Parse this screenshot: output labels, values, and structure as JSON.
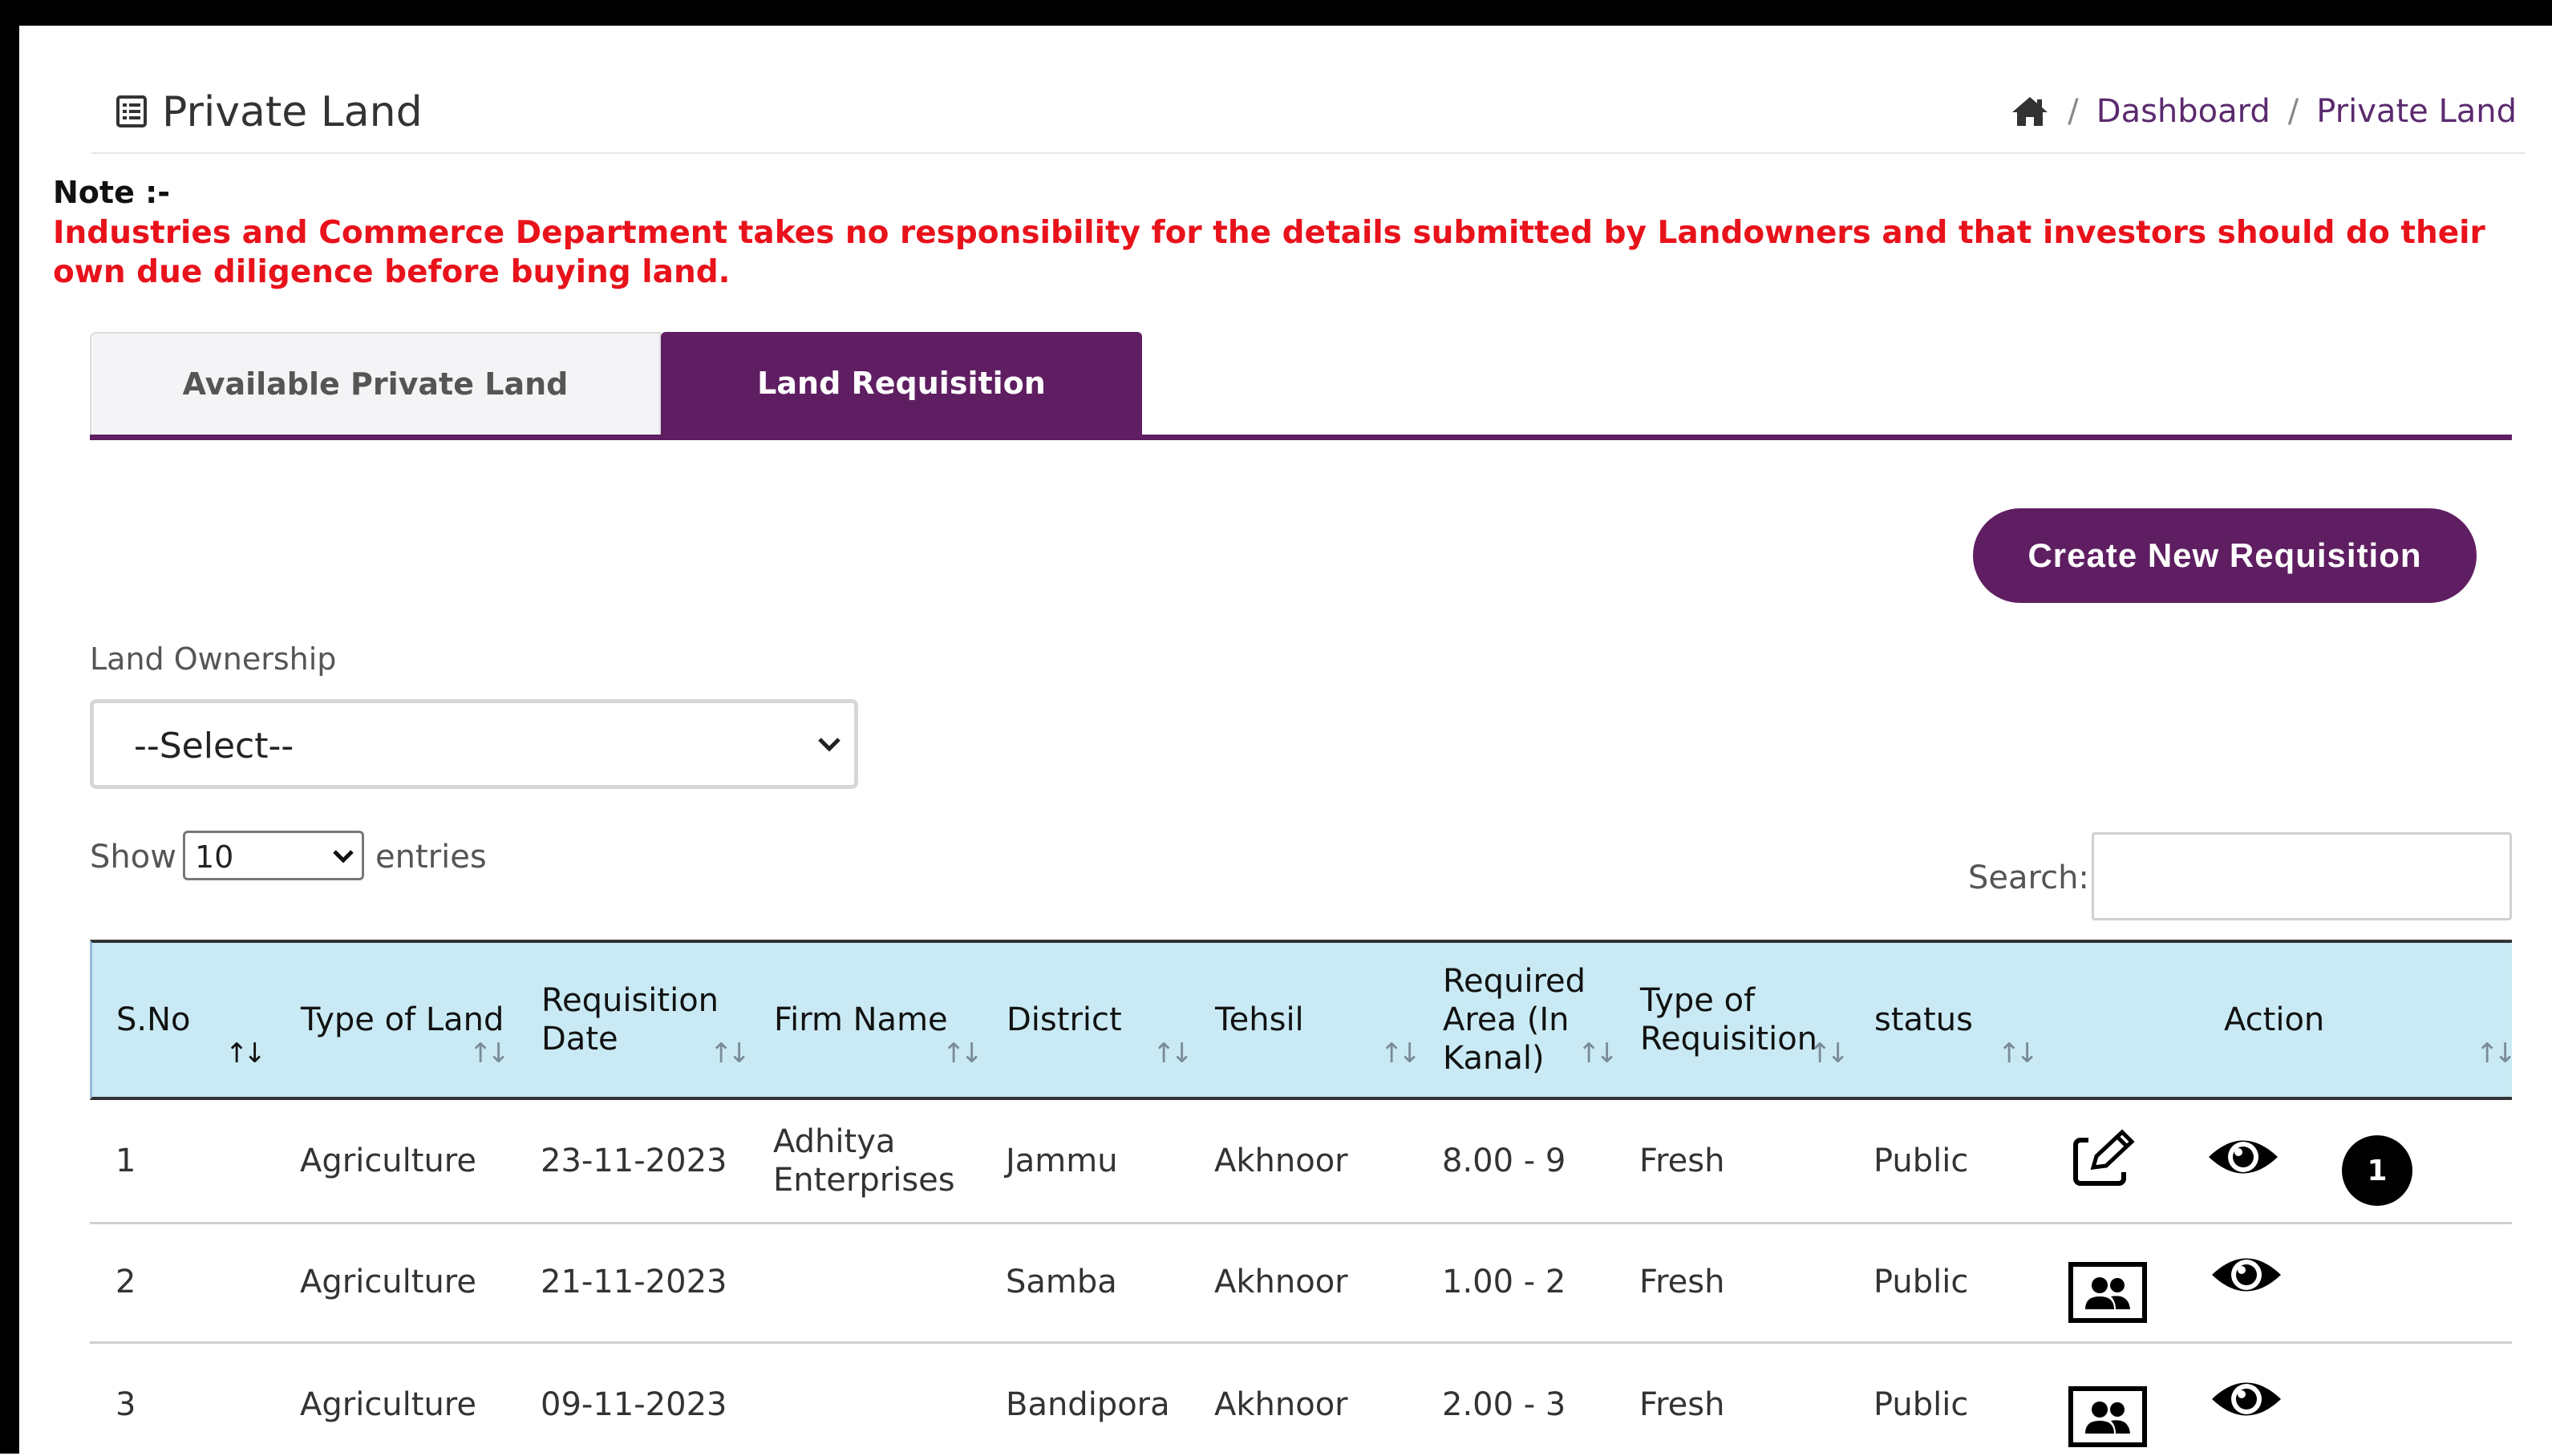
{
  "header": {
    "title": "Private Land",
    "breadcrumb": [
      "Dashboard",
      "Private Land"
    ],
    "separator": "/"
  },
  "note": {
    "label": "Note :-",
    "text": "Industries and Commerce Department takes no responsibility for the details submitted by Landowners and that investors should do their own due diligence before buying land."
  },
  "tabs": [
    {
      "label": "Available Private Land",
      "active": false
    },
    {
      "label": "Land Requisition",
      "active": true
    }
  ],
  "create_button": "Create New Requisition",
  "filters": {
    "ownership_label": "Land Ownership",
    "ownership_value": "--Select--",
    "show_label": "Show",
    "entries_value": "10",
    "entries_label": "entries",
    "search_label": "Search:",
    "search_value": ""
  },
  "table": {
    "columns": [
      "S.No",
      "Type of Land",
      "Requisition Date",
      "Firm Name",
      "District",
      "Tehsil",
      "Required Area (In Kanal)",
      "Type of Requisition",
      "status",
      "Action"
    ],
    "rows": [
      {
        "sno": "1",
        "type": "Agriculture",
        "date": "23-11-2023",
        "firm": "Adhitya Enterprises",
        "district": "Jammu",
        "tehsil": "Akhnoor",
        "area": "8.00 - 9",
        "req_type": "Fresh",
        "status": "Public",
        "first_action_icon": "edit-icon",
        "badge": "1"
      },
      {
        "sno": "2",
        "type": "Agriculture",
        "date": "21-11-2023",
        "firm": "",
        "district": "Samba",
        "tehsil": "Akhnoor",
        "area": "1.00 - 2",
        "req_type": "Fresh",
        "status": "Public",
        "first_action_icon": "users-icon",
        "badge": ""
      },
      {
        "sno": "3",
        "type": "Agriculture",
        "date": "09-11-2023",
        "firm": "",
        "district": "Bandipora",
        "tehsil": "Akhnoor",
        "area": "2.00 - 3",
        "req_type": "Fresh",
        "status": "Public",
        "first_action_icon": "users-icon",
        "badge": ""
      }
    ]
  },
  "colors": {
    "brand": "#5f1e62",
    "note": "#e8121b",
    "table_header": "#c9eaf4"
  }
}
